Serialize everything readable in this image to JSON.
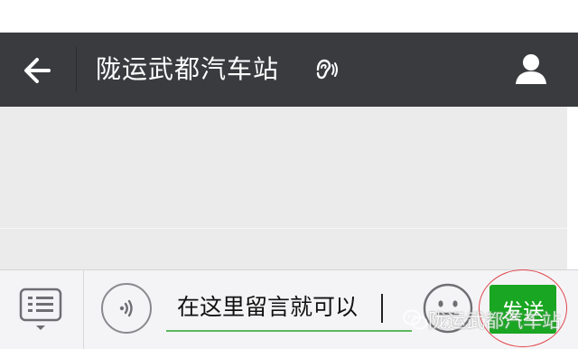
{
  "header": {
    "title": "陇运武都汽车站",
    "icons": {
      "back": "arrow-left-icon",
      "sound": "ear-sound-icon",
      "profile": "person-icon"
    }
  },
  "input_bar": {
    "message_value": "在这里留言就可以",
    "send_label": "发送",
    "icons": {
      "menu": "keyboard-menu-icon",
      "voice": "voice-icon",
      "emoji": "emoji-face-icon"
    }
  },
  "watermark": {
    "text": "陇运武都汽车站",
    "icon": "wechat-logo-icon"
  },
  "colors": {
    "header_bg": "#3a3b3f",
    "chat_bg": "#ebebeb",
    "send_bg": "#19a622",
    "input_underline": "#5cb85c",
    "highlight_ring": "#e0454b"
  }
}
